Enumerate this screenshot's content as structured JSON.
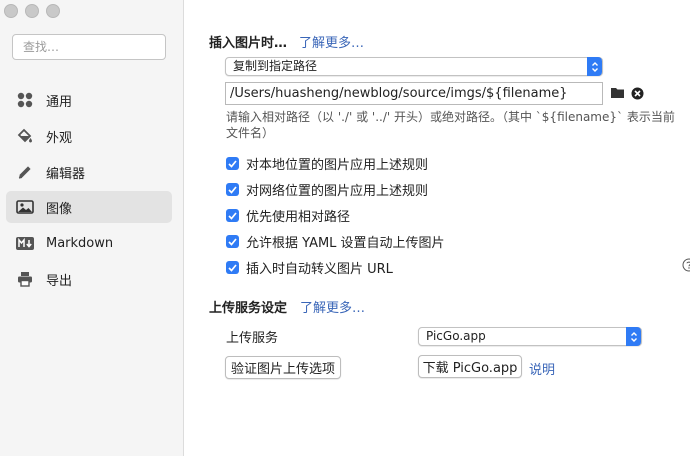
{
  "sidebar": {
    "search_placeholder": "查找…",
    "items": [
      {
        "label": "通用",
        "icon": "grid-icon"
      },
      {
        "label": "外观",
        "icon": "paint-bucket-icon"
      },
      {
        "label": "编辑器",
        "icon": "pencil-icon"
      },
      {
        "label": "图像",
        "icon": "image-icon",
        "active": true
      },
      {
        "label": "Markdown",
        "icon": "markdown-icon"
      },
      {
        "label": "导出",
        "icon": "printer-icon"
      }
    ]
  },
  "insert": {
    "title": "插入图片时…",
    "learn_more": "了解更多…",
    "action_select": "复制到指定路径",
    "path_value": "/Users/huasheng/newblog/source/imgs/${filename}",
    "hint": "请输入相对路径（以 './' 或 '../' 开头）或绝对路径。（其中 `${filename}` 表示当前文件名）",
    "options": [
      {
        "label": "对本地位置的图片应用上述规则",
        "checked": true
      },
      {
        "label": "对网络位置的图片应用上述规则",
        "checked": true
      },
      {
        "label": "优先使用相对路径",
        "checked": true
      },
      {
        "label": "允许根据 YAML 设置自动上传图片",
        "checked": true
      },
      {
        "label": "插入时自动转义图片 URL",
        "checked": true
      }
    ]
  },
  "upload": {
    "title": "上传服务设定",
    "learn_more": "了解更多…",
    "service_label": "上传服务",
    "service_value": "PicGo.app",
    "verify_button": "验证图片上传选项",
    "download_button": "下载 PicGo.app",
    "explain_link": "说明"
  },
  "colors": {
    "accent": "#2f7bf5",
    "link": "#3a66b8"
  }
}
